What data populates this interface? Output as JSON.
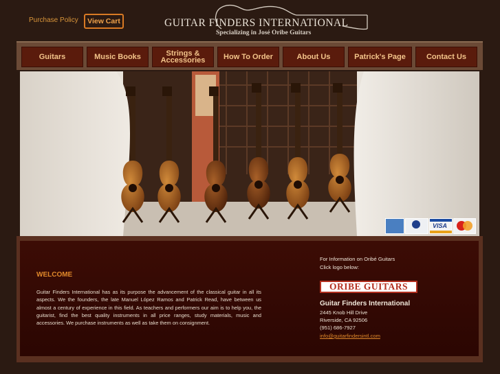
{
  "topbar": {
    "purchase_policy": "Purchase Policy",
    "view_cart": "View Cart"
  },
  "logo": {
    "title": "GUITAR FINDERS INTERNATIONAL",
    "subtitle": "Specializing in José Oribe Guitars"
  },
  "nav": {
    "items": [
      {
        "label": "Guitars"
      },
      {
        "label": "Music Books"
      },
      {
        "label": "Strings & Accessories"
      },
      {
        "label": "How To Order"
      },
      {
        "label": "About Us"
      },
      {
        "label": "Patrick's Page"
      },
      {
        "label": "Contact Us"
      }
    ]
  },
  "payment_cards": [
    "American Express",
    "Diners Club International",
    "VISA",
    "MasterCard"
  ],
  "welcome": {
    "heading": "WELCOME",
    "body": "Guitar Finders International has as its purpose the advancement of the classical guitar in all its aspects. We the founders, the late Manuel López Ramos and Patrick Read, have between us almost a century of experience in this field. As teachers and performers our aim is to help you, the guitarist, find the best quality instruments in all price ranges, study materials, music and accessories. We purchase instruments as well as take them on consignment."
  },
  "sidebar": {
    "info_line1": "For Information on Oribé Guitars",
    "info_line2": "Click logo below:",
    "oribe_logo_text": "ORIBE GUITARS",
    "company": "Guitar Finders International",
    "address1": "2445 Knob Hill Drive",
    "address2": "Riverside, CA 92506",
    "phone": "(951) 686-7927",
    "email": "info@guitarfindersintl.com"
  },
  "colors": {
    "background": "#2b1a12",
    "nav_button": "#5a1b0c",
    "nav_text": "#f3c48a",
    "accent_orange": "#e0882a",
    "panel": "#3c0c05"
  }
}
